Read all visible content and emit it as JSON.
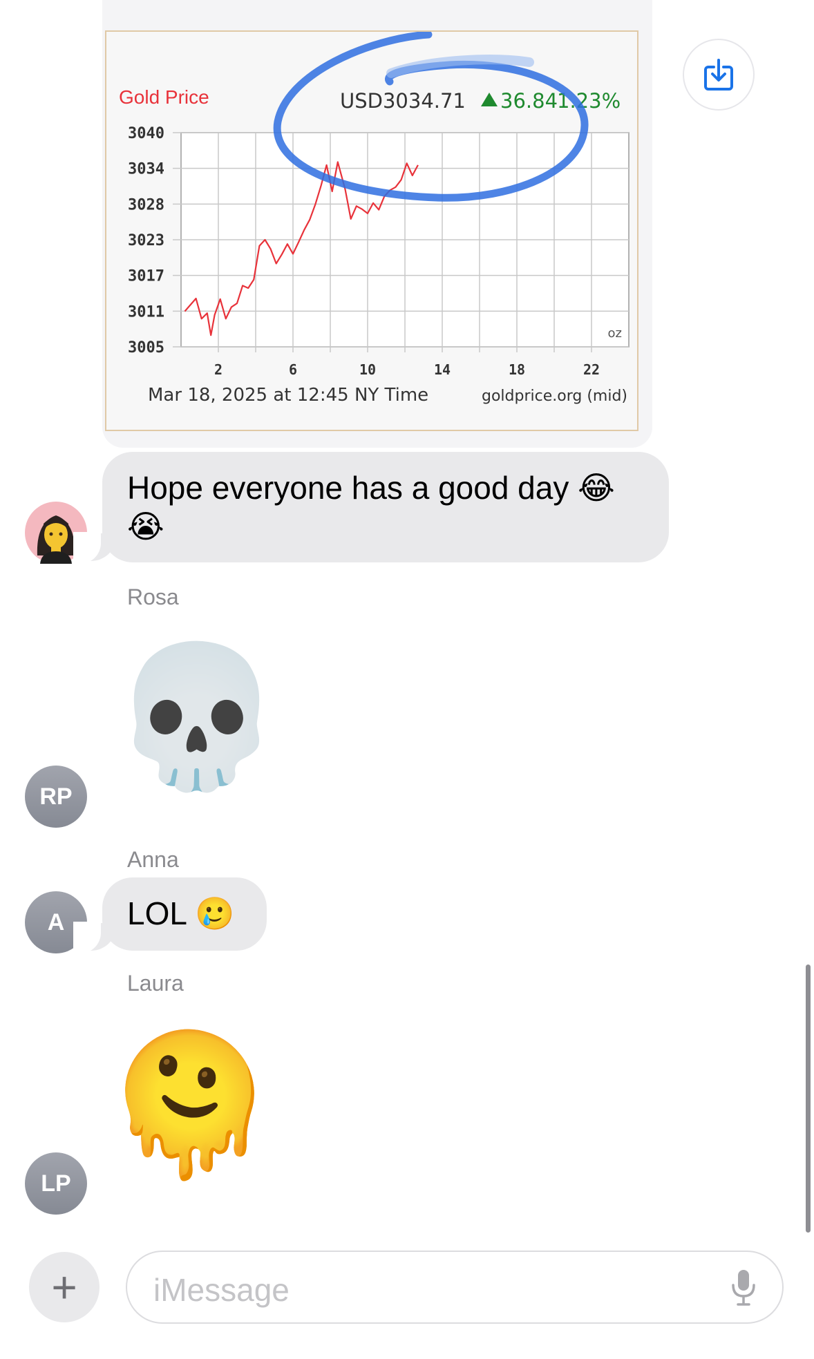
{
  "attachment": {
    "chart_data": {
      "type": "line",
      "title": "Gold Price",
      "price_label": "USD3034.71",
      "change_value": "36.84",
      "change_percent": "1.23%",
      "unit_label": "oz",
      "footer_left": "Mar 18, 2025 at 12:45 NY Time",
      "footer_right": "goldprice.org (mid)",
      "y_ticks": [
        "3040",
        "3034",
        "3028",
        "3023",
        "3017",
        "3011",
        "3005"
      ],
      "x_ticks": [
        "2",
        "6",
        "10",
        "14",
        "18",
        "22"
      ],
      "ylim": [
        3005,
        3040
      ],
      "xlim": [
        0,
        24
      ],
      "grid": true,
      "series": [
        {
          "color": "#e8323a",
          "x": [
            0.2,
            0.8,
            1.1,
            1.4,
            1.6,
            1.8,
            2.1,
            2.4,
            2.7,
            3.0,
            3.3,
            3.6,
            3.9,
            4.2,
            4.5,
            4.8,
            5.1,
            5.4,
            5.7,
            6.0,
            6.3,
            6.6,
            6.9,
            7.2,
            7.5,
            7.8,
            8.1,
            8.4,
            8.8,
            9.1,
            9.4,
            9.7,
            10.0,
            10.3,
            10.6,
            10.9,
            11.2,
            11.5,
            11.8,
            12.1,
            12.4,
            12.7
          ],
          "values": [
            3010.8,
            3012.9,
            3009.6,
            3010.5,
            3006.9,
            3010.2,
            3012.8,
            3009.6,
            3011.5,
            3012.1,
            3015.0,
            3014.6,
            3016.0,
            3021.5,
            3022.5,
            3021.0,
            3018.6,
            3020.1,
            3021.8,
            3020.2,
            3022.1,
            3024.1,
            3025.8,
            3028.3,
            3031.3,
            3034.7,
            3030.4,
            3035.2,
            3030.7,
            3025.9,
            3028.0,
            3027.5,
            3026.8,
            3028.5,
            3027.4,
            3029.6,
            3030.6,
            3031.1,
            3032.3,
            3035.0,
            3033.0,
            3034.7
          ]
        }
      ]
    }
  },
  "messages": {
    "hope_text": "Hope everyone has a good day 😂",
    "hope_text_line2": "😭",
    "rosa_name": "Rosa",
    "rosa_emoji": "💀",
    "rosa_avatar": "RP",
    "anna_name": "Anna",
    "anna_text": "LOL 🥲",
    "anna_avatar": "A",
    "laura_name": "Laura",
    "laura_emoji": "🫠",
    "laura_avatar": "LP",
    "first_avatar_icon": "person-avatar-icon"
  },
  "composer": {
    "placeholder": "iMessage",
    "plus_label": "+"
  }
}
